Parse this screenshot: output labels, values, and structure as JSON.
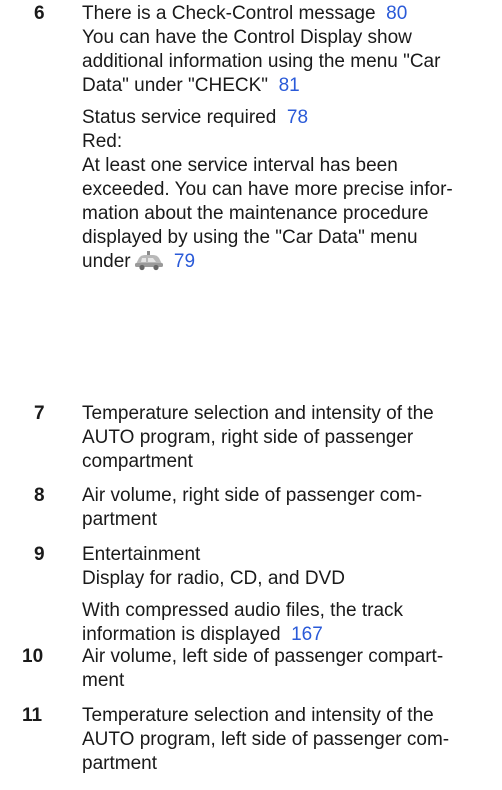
{
  "items": [
    {
      "number": "6",
      "lines_a": [
        {
          "text": "There is a Check-Control message",
          "ref": "80"
        },
        {
          "text": "You can have the Control Display show"
        },
        {
          "text": "additional information using the menu \"Car"
        },
        {
          "text": "Data\" under \"CHECK\"",
          "ref": "81"
        }
      ],
      "lines_b": [
        {
          "text": "Status service required",
          "ref": "78"
        },
        {
          "text": "Red:"
        },
        {
          "text": "At least one service interval has been"
        },
        {
          "text": "exceeded. You can have more precise infor-"
        },
        {
          "text": "mation about the maintenance procedure"
        },
        {
          "text": "displayed by using the \"Car Data\" menu"
        },
        {
          "text": "under",
          "icon": "car-check-icon",
          "ref": "79"
        }
      ]
    },
    {
      "number": "7",
      "lines": [
        "Temperature selection and intensity of the",
        "AUTO program, right side of passenger",
        "compartment"
      ]
    },
    {
      "number": "8",
      "lines": [
        "Air volume, right side of passenger com-",
        "partment"
      ]
    },
    {
      "number": "9",
      "lines_a": [
        {
          "text": "Entertainment"
        },
        {
          "text": "Display for radio, CD, and DVD"
        }
      ],
      "lines_b": [
        {
          "text": "With compressed audio files, the track"
        },
        {
          "text": "information is displayed",
          "ref": "167"
        }
      ]
    },
    {
      "number": "10",
      "lines": [
        "Air volume, left side of passenger compart-",
        "ment"
      ]
    },
    {
      "number": "11",
      "lines": [
        "Temperature selection and intensity of the",
        "AUTO program, left side of passenger com-",
        "partment"
      ]
    }
  ],
  "colors": {
    "text": "#1a1a1a",
    "link": "#2a5ad8"
  }
}
